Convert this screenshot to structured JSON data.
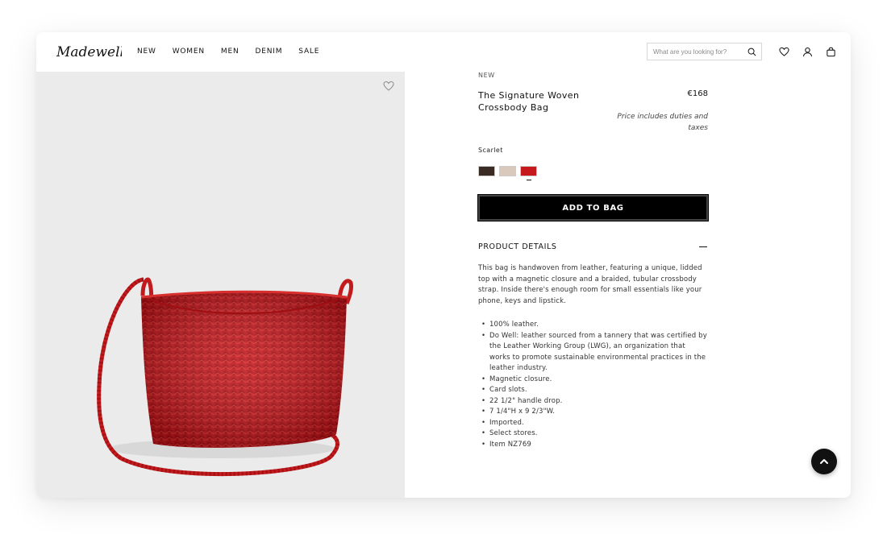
{
  "header": {
    "logo_text": "Madewell",
    "nav": [
      "NEW",
      "WOMEN",
      "MEN",
      "DENIM",
      "SALE"
    ],
    "search_placeholder": "What are you looking for?",
    "icons": [
      "search-icon",
      "heart-icon",
      "user-icon",
      "bag-icon"
    ]
  },
  "product": {
    "badge": "NEW",
    "title": "The Signature Woven Crossbody Bag",
    "price": "€168",
    "price_note": "Price includes duties and taxes",
    "color_name": "Scarlet",
    "swatches": [
      {
        "name": "dark brown",
        "color": "#3a2a24"
      },
      {
        "name": "natural",
        "color": "#d9c8bc"
      },
      {
        "name": "scarlet",
        "color": "#c6191c",
        "selected": true
      }
    ],
    "add_to_bag": "ADD TO BAG",
    "details_heading": "PRODUCT DETAILS",
    "description": "This bag is handwoven from leather, featuring a unique, lidded top with a magnetic closure and a braided, tubular crossbody strap. Inside there's enough room for small essentials like your phone, keys and lipstick.",
    "details": [
      "100% leather.",
      "Do Well: leather sourced from a tannery that was certified by the Leather Working Group (LWG), an organization that works to promote sustainable environmental practices in the leather industry.",
      "Magnetic closure.",
      "Card slots.",
      "22 1/2\" handle drop.",
      "7 1/4\"H x 9 2/3\"W.",
      "Imported.",
      "Select stores.",
      "Item NZ769"
    ]
  },
  "colors": {
    "accent": "#000000",
    "image_bg": "#ebebeb",
    "bag": "#c6191c"
  }
}
